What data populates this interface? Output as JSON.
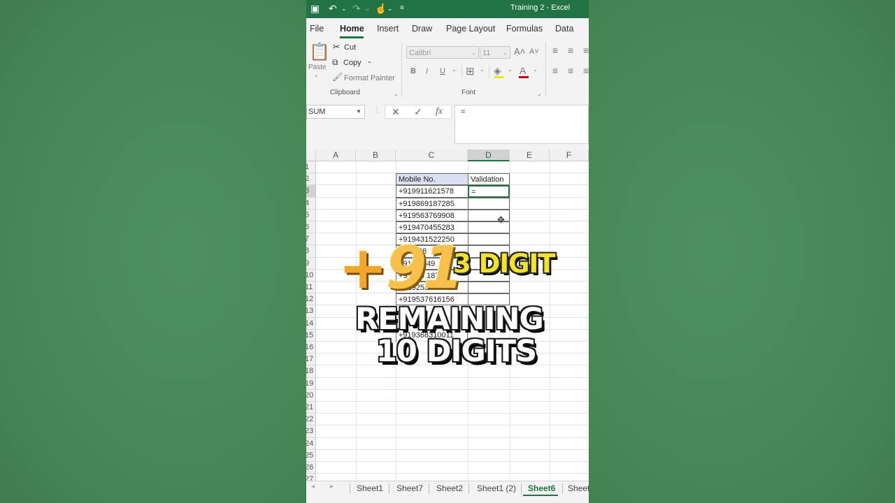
{
  "window": {
    "title": "Training 2  -  Excel"
  },
  "ribbon_tabs": [
    "File",
    "Home",
    "Insert",
    "Draw",
    "Page Layout",
    "Formulas",
    "Data"
  ],
  "clipboard": {
    "paste": "Paste",
    "cut": "Cut",
    "copy": "Copy",
    "format_painter": "Format Painter",
    "label": "Clipboard"
  },
  "font_group": {
    "font_name": "Calibri",
    "font_size": "11",
    "bold": "B",
    "italic": "I",
    "underline": "U",
    "label": "Font"
  },
  "formula_bar": {
    "name_box": "SUM",
    "cancel": "✕",
    "enter": "✓",
    "fx": "fx",
    "formula": "="
  },
  "columns": [
    "A",
    "B",
    "C",
    "D",
    "E",
    "F"
  ],
  "rows": [
    "1",
    "2",
    "3",
    "4",
    "5",
    "6",
    "7",
    "8",
    "9",
    "10",
    "11",
    "12",
    "13",
    "14",
    "15",
    "16",
    "17",
    "18",
    "19",
    "20",
    "21",
    "22",
    "23",
    "24",
    "25",
    "26",
    "27"
  ],
  "table": {
    "header_c": "Mobile No.",
    "header_d": "Validation",
    "active_cell_value": "=",
    "numbers": [
      "+919911621578",
      "+919869187285",
      "+919563769908",
      "+919470455283",
      "+919431522250",
      "+91        768",
      "+9193    449",
      "+91949  18719",
      "+919253370696",
      "+919537616156"
    ],
    "extra_number": "+919368310011"
  },
  "sheet_tabs": [
    "Sheet1",
    "Sheet7",
    "Sheet2",
    "Sheet1 (2)",
    "Sheet6",
    "Sheet"
  ],
  "active_sheet": "Sheet6",
  "overlay": {
    "plus": "+",
    "code": "91",
    "three_digit": "3 DIGIT",
    "remaining": "REMAINING",
    "ten_digits": "10 DIGITS"
  },
  "colors": {
    "excel_green": "#217346",
    "background": "#4a8a5a",
    "header_fill": "#d9e1f2"
  }
}
